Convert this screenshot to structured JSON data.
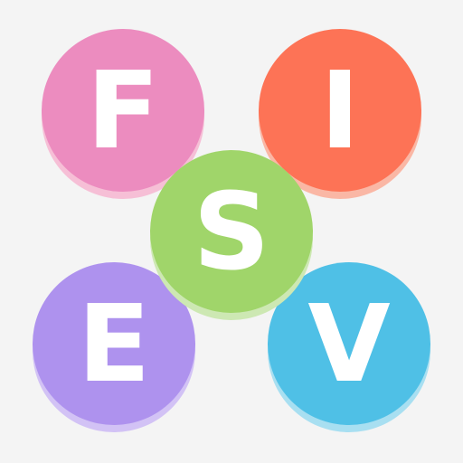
{
  "tiles": [
    {
      "letter": "F",
      "color": "#ec8cbf"
    },
    {
      "letter": "I",
      "color": "#fd7356"
    },
    {
      "letter": "S",
      "color": "#a0d56a"
    },
    {
      "letter": "E",
      "color": "#ae92ee"
    },
    {
      "letter": "V",
      "color": "#4fc0e6"
    }
  ],
  "background": "#f4f4f4"
}
